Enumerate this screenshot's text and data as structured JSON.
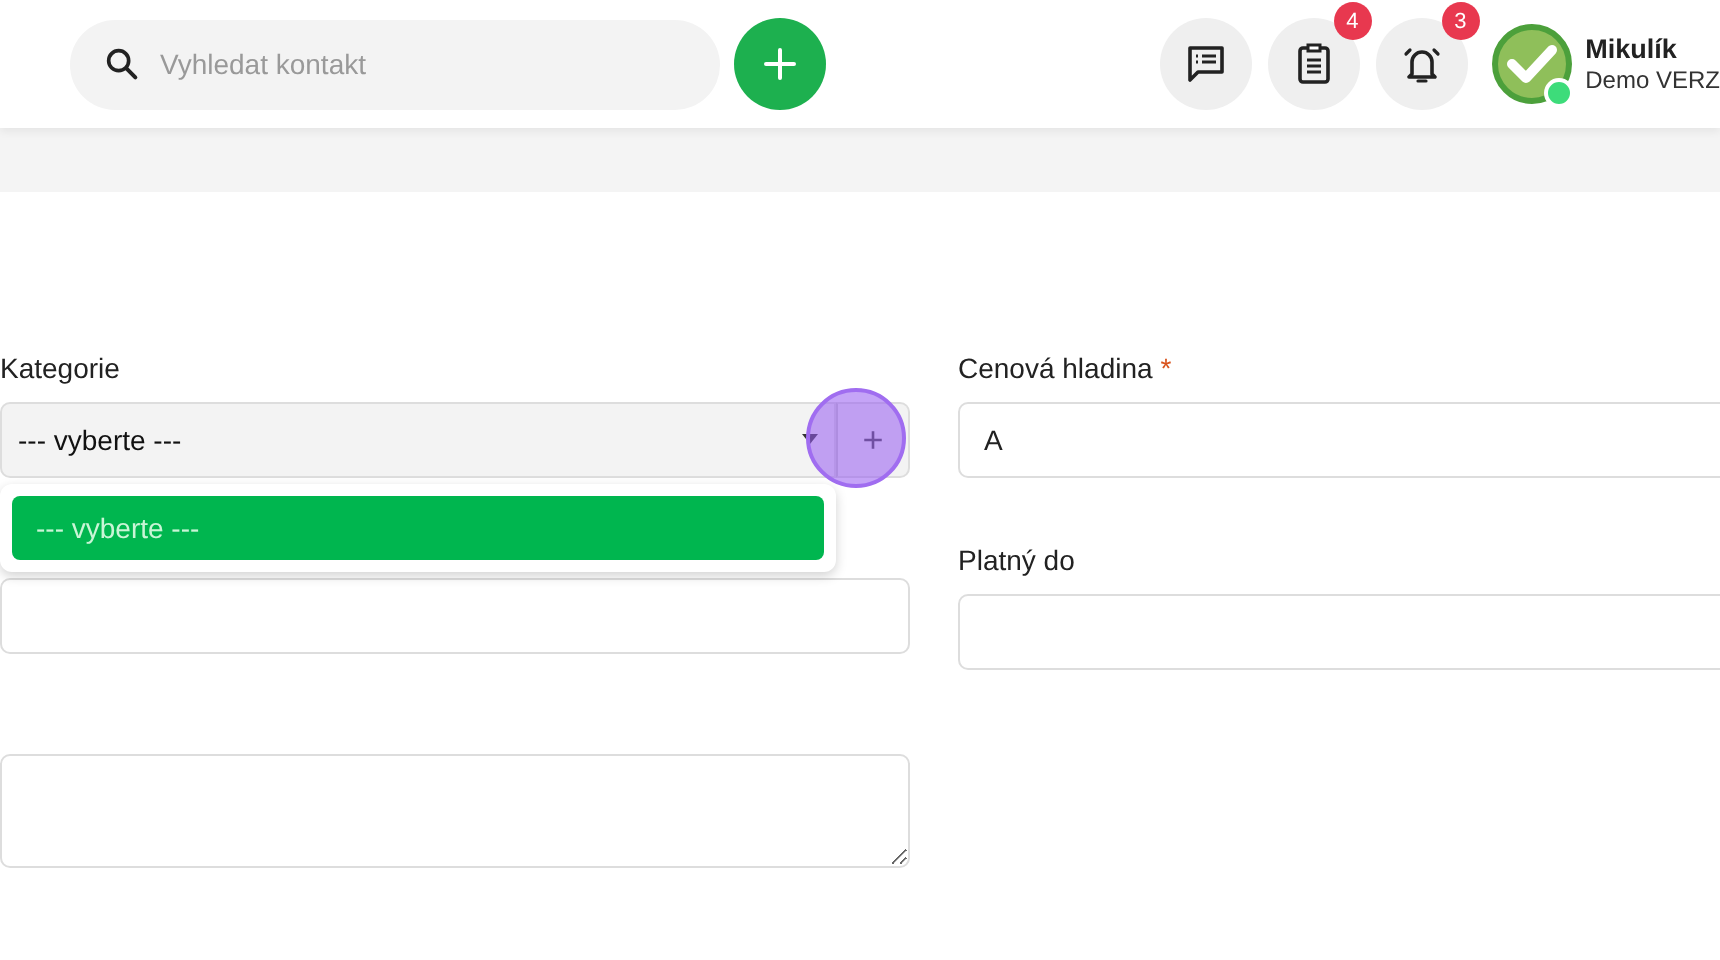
{
  "header": {
    "search": {
      "placeholder": "Vyhledat kontakt"
    },
    "actions": [
      {
        "kind": "messages"
      },
      {
        "kind": "clipboard",
        "badge": "4"
      },
      {
        "kind": "bell",
        "badge": "3"
      }
    ],
    "user": {
      "name": "Mikulík",
      "subtitle": "Demo VERZ",
      "online": true
    }
  },
  "form": {
    "category": {
      "label": "Kategorie",
      "value": "--- vyberte ---",
      "add": "+",
      "open": true,
      "options": [
        {
          "label": "--- vyberte ---",
          "selected": true
        }
      ]
    },
    "price_level": {
      "label": "Cenová hladina",
      "required_mark": "*",
      "value": "A"
    },
    "valid_to": {
      "label": "Platný do"
    }
  }
}
